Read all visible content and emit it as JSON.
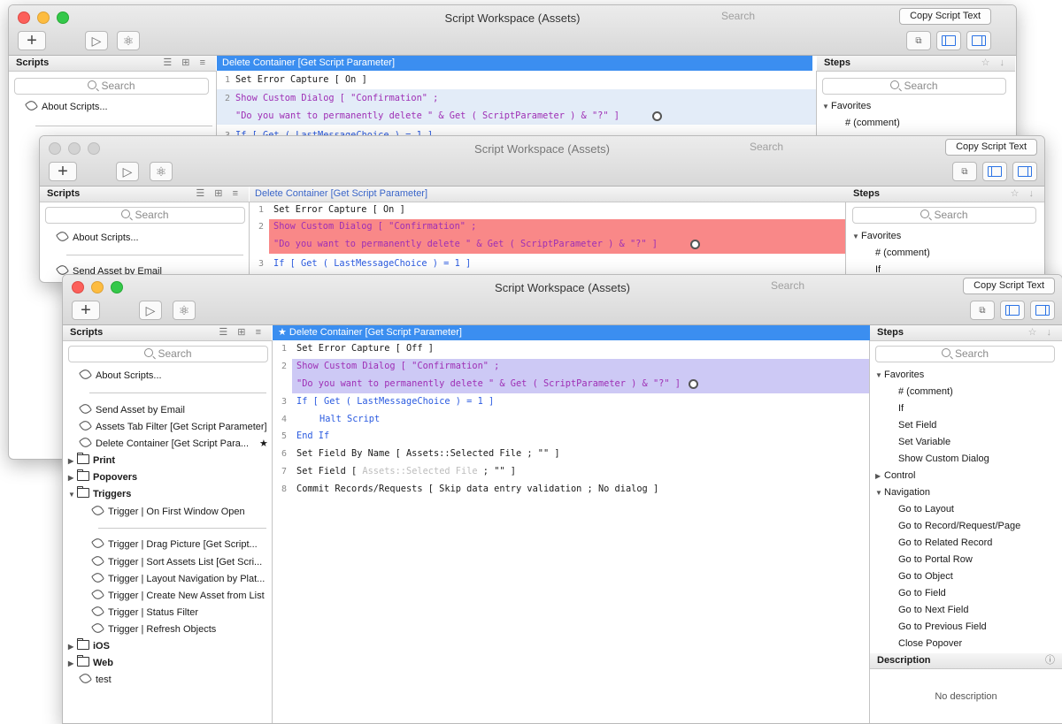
{
  "window_title": "Script Workspace (Assets)",
  "title_search": "Search",
  "copy_button": "Copy Script Text",
  "toolbar": {
    "add": "+",
    "run": "▷",
    "debug": "⚛"
  },
  "scripts_header": "Scripts",
  "steps_header": "Steps",
  "search_placeholder": "Search",
  "back_windows": {
    "script_title": "Delete Container [Get Script Parameter]",
    "about": "About Scripts...",
    "send": "Send Asset by Email",
    "lines": {
      "n1": "1",
      "n2": "2",
      "n3": "3",
      "l1_top": "Set Error Capture [ On ]",
      "l1_mid": "Set Error Capture [ On ]",
      "l2a": "Show Custom Dialog [ \"Confirmation\" ;",
      "l2b": "\"Do you want to permanently delete \" & Get ( ScriptParameter ) & \"?\" ]",
      "l3": "If [ Get ( LastMessageChoice ) = 1 ]"
    },
    "steps": {
      "favorites": "Favorites",
      "comment": "# (comment)",
      "if": "If"
    }
  },
  "front": {
    "script_title": "★ Delete Container [Get Script Parameter]",
    "scripts_list": {
      "about": "About Scripts...",
      "send": "Send Asset by Email",
      "assets_tab": "Assets Tab Filter [Get Script Parameter]",
      "delete_container": "Delete Container [Get Script Para...",
      "delete_star": "★",
      "print": "Print",
      "popovers": "Popovers",
      "triggers": "Triggers",
      "trigger_first": "Trigger | On First Window Open",
      "trigger_drag": "Trigger | Drag Picture [Get Script...",
      "trigger_sort": "Trigger | Sort Assets List [Get Scri...",
      "trigger_layout": "Trigger | Layout Navigation by Plat...",
      "trigger_create": "Trigger | Create New Asset from List",
      "trigger_status": "Trigger | Status Filter",
      "trigger_refresh": "Trigger | Refresh Objects",
      "ios": "iOS",
      "web": "Web",
      "test": "test"
    },
    "code": {
      "n1": "1",
      "n2": "2",
      "n3": "3",
      "n4": "4",
      "n5": "5",
      "n6": "6",
      "n7": "7",
      "n8": "8",
      "l1": "Set Error Capture [ Off ]",
      "l2a": "Show Custom Dialog [ \"Confirmation\" ;",
      "l2b": "\"Do you want to permanently delete \" & Get ( ScriptParameter ) & \"?\" ]",
      "l3a": "If",
      "l3b": " [ Get ( LastMessageChoice ) = 1 ]",
      "l4": "Halt Script",
      "l5": "End If",
      "l6": "Set Field By Name [ Assets::Selected File ; \"\" ]",
      "l7a": "Set Field [ ",
      "l7b": "Assets::Selected File",
      "l7c": " ; \"\" ]",
      "l8": "Commit Records/Requests [ Skip data entry validation ; No dialog ]"
    },
    "steps": {
      "favorites": "Favorites",
      "comment": "# (comment)",
      "if": "If",
      "set_field": "Set Field",
      "set_variable": "Set Variable",
      "show_custom_dialog": "Show Custom Dialog",
      "control": "Control",
      "navigation": "Navigation",
      "nav_items": [
        "Go to Layout",
        "Go to Record/Request/Page",
        "Go to Related Record",
        "Go to Portal Row",
        "Go to Object",
        "Go to Field",
        "Go to Next Field",
        "Go to Previous Field",
        "Close Popover"
      ]
    },
    "description_header": "Description",
    "description_text": "No description"
  },
  "colors": {
    "accent": "#3b8ef0",
    "selection_light": "#e3ecf8",
    "selection_red": "#f98888",
    "selection_purple": "#cdc9f5"
  }
}
